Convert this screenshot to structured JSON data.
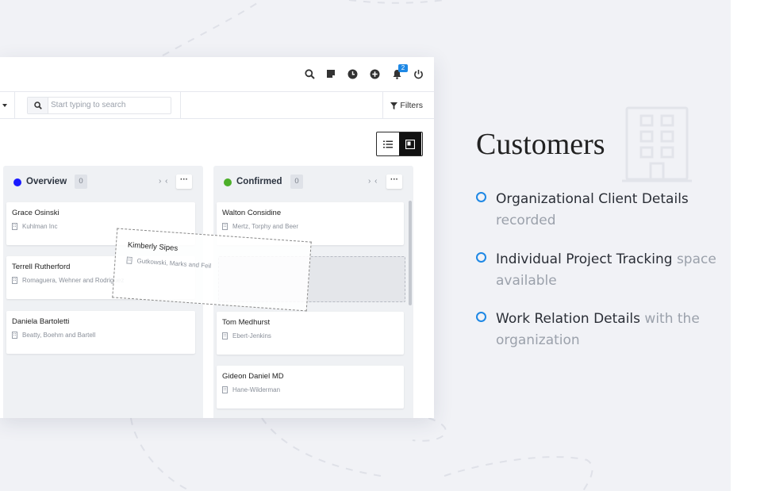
{
  "icons": {
    "topbar": [
      "search-icon",
      "note-icon",
      "clock-icon",
      "plus-circle-icon",
      "bell-icon",
      "power-icon"
    ],
    "filter": "filter-icon",
    "view_list": "list-view-icon",
    "view_board": "board-view-icon",
    "company": "building-icon"
  },
  "colors": {
    "accent": "#1e88e5",
    "overview_dot": "#1a1aff",
    "confirmed_dot": "#4caf29"
  },
  "topbar": {
    "notification_count": "2"
  },
  "toolbar": {
    "search_placeholder": "Start typing to search",
    "filters_label": "Filters"
  },
  "columns": [
    {
      "title": "Overview",
      "count": "0",
      "arrows": "› ‹",
      "more": "···",
      "cards": [
        {
          "name": "Grace Osinski",
          "company": "Kuhlman Inc"
        },
        {
          "name": "Terrell Rutherford",
          "company": "Romaguera, Wehner and Rodriguez"
        },
        {
          "name": "Daniela Bartoletti",
          "company": "Beatty, Boehm and Bartell"
        }
      ]
    },
    {
      "title": "Confirmed",
      "count": "0",
      "arrows": "› ‹",
      "more": "···",
      "cards": [
        {
          "name": "Walton Considine",
          "company": "Mertz, Torphy and Beer"
        },
        {
          "name": "Tom Medhurst",
          "company": "Ebert-Jenkins"
        },
        {
          "name": "Gideon Daniel MD",
          "company": "Hane-Wilderman"
        }
      ]
    }
  ],
  "drag_card": {
    "name": "Kimberly Sipes",
    "company": "Gutkowski, Marks and Feil"
  },
  "info": {
    "title": "Customers",
    "features": [
      {
        "strong": "Organizational Client Details",
        "muted": "recorded"
      },
      {
        "strong": "Individual Project Tracking",
        "muted": "space available"
      },
      {
        "strong": "Work Relation Details",
        "muted": "with the organization"
      }
    ]
  }
}
